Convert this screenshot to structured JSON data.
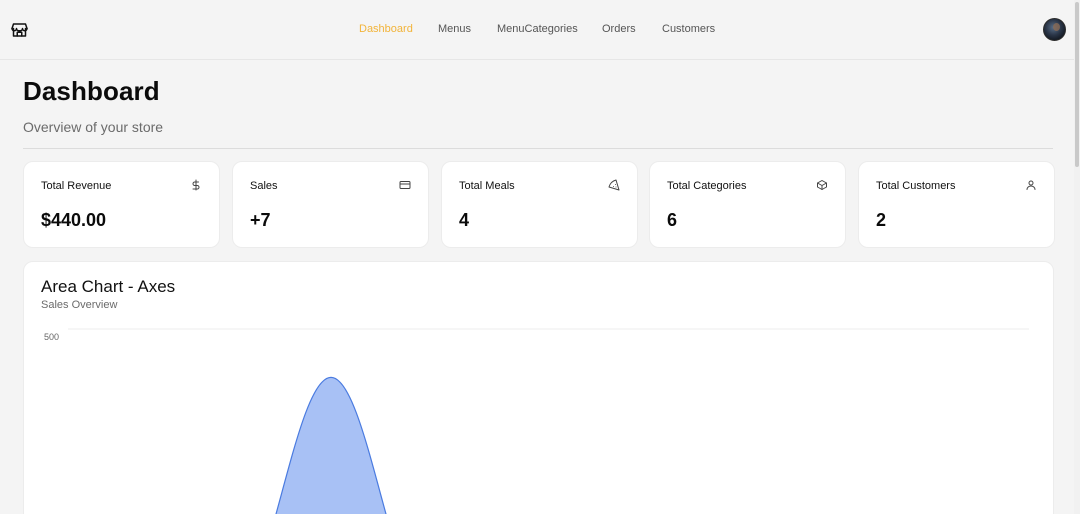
{
  "nav": {
    "items": [
      {
        "label": "Dashboard",
        "active": true
      },
      {
        "label": "Menus",
        "active": false
      },
      {
        "label": "MenuCategories",
        "active": false
      },
      {
        "label": "Orders",
        "active": false
      },
      {
        "label": "Customers",
        "active": false
      }
    ],
    "brand_icon": "store-icon",
    "avatar": "user-avatar"
  },
  "header": {
    "title": "Dashboard",
    "subtitle": "Overview of your store"
  },
  "stats": [
    {
      "label": "Total Revenue",
      "value": "$440.00",
      "icon": "dollar-icon"
    },
    {
      "label": "Sales",
      "value": "+7",
      "icon": "credit-card-icon"
    },
    {
      "label": "Total Meals",
      "value": "4",
      "icon": "meal-icon"
    },
    {
      "label": "Total Categories",
      "value": "6",
      "icon": "box-icon"
    },
    {
      "label": "Total Customers",
      "value": "2",
      "icon": "user-icon"
    }
  ],
  "chart": {
    "title": "Area Chart - Axes",
    "subtitle": "Sales Overview"
  },
  "chart_data": {
    "type": "area",
    "title": "Area Chart - Axes",
    "subtitle": "Sales Overview",
    "y_ticks": [
      "500"
    ],
    "ylim": [
      0,
      500
    ],
    "peak_value": 440,
    "fill_color": "#a8c1f5",
    "stroke_color": "#4a7be0",
    "grid": true
  },
  "colors": {
    "accent": "#f2b43a",
    "background": "#f4f4f4",
    "card": "#ffffff"
  }
}
